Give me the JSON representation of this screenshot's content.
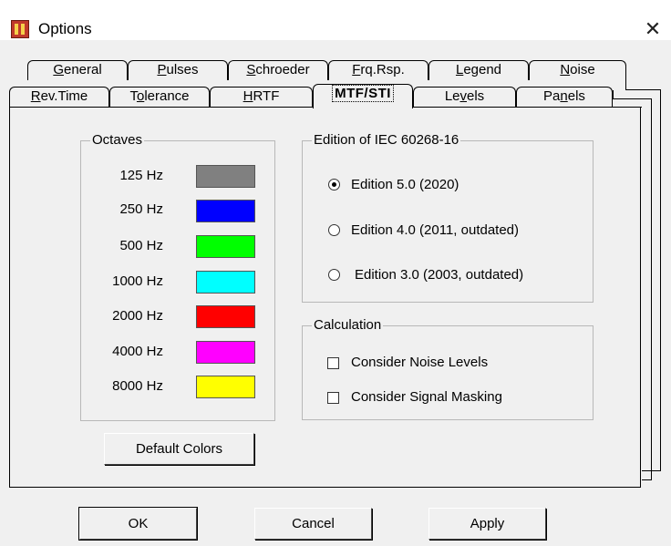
{
  "window": {
    "title": "Options"
  },
  "tabs_back": [
    {
      "label": "General",
      "ul": "G",
      "rest": "eneral"
    },
    {
      "label": "Pulses",
      "ul": "P",
      "rest": "ulses"
    },
    {
      "label": "Schroeder",
      "ul": "S",
      "rest": "chroeder"
    },
    {
      "label": "Frq.Rsp.",
      "ul": "F",
      "rest": "rq.Rsp."
    },
    {
      "label": "Legend",
      "ul": "L",
      "rest": "egend"
    },
    {
      "label": "Noise",
      "ul": "N",
      "rest": "oise"
    }
  ],
  "tabs_front": [
    {
      "label": "Rev.Time",
      "pre": "",
      "ul": "R",
      "rest": "ev.Time"
    },
    {
      "label": "Tolerance",
      "pre": "T",
      "ul": "o",
      "rest": "lerance"
    },
    {
      "label": "HRTF",
      "pre": "",
      "ul": "H",
      "rest": "RTF"
    },
    {
      "label": "MTF/STI",
      "selected": true
    },
    {
      "label": "Levels",
      "pre": "Le",
      "ul": "v",
      "rest": "els"
    },
    {
      "label": "Panels",
      "pre": "Pa",
      "ul": "n",
      "rest": "els"
    }
  ],
  "octaves": {
    "title": "Octaves",
    "items": [
      {
        "label": "125 Hz",
        "color": "#808080"
      },
      {
        "label": "250 Hz",
        "color": "#0000ff"
      },
      {
        "label": "500 Hz",
        "color": "#00ff00"
      },
      {
        "label": "1000 Hz",
        "color": "#00ffff"
      },
      {
        "label": "2000 Hz",
        "color": "#ff0000"
      },
      {
        "label": "4000 Hz",
        "color": "#ff00ff"
      },
      {
        "label": "8000 Hz",
        "color": "#ffff00"
      }
    ],
    "default_colors_label": "Default Colors"
  },
  "edition": {
    "title": "Edition of IEC 60268-16",
    "options": [
      {
        "label": "Edition 5.0 (2020)",
        "checked": true
      },
      {
        "label": "Edition 4.0 (2011, outdated)",
        "checked": false
      },
      {
        "label": "Edition 3.0 (2003, outdated)",
        "checked": false
      }
    ]
  },
  "calculation": {
    "title": "Calculation",
    "options": [
      {
        "label": "Consider Noise Levels",
        "checked": false
      },
      {
        "label": "Consider Signal Masking",
        "checked": false
      }
    ]
  },
  "footer": {
    "ok": "OK",
    "cancel": "Cancel",
    "apply": "Apply"
  }
}
